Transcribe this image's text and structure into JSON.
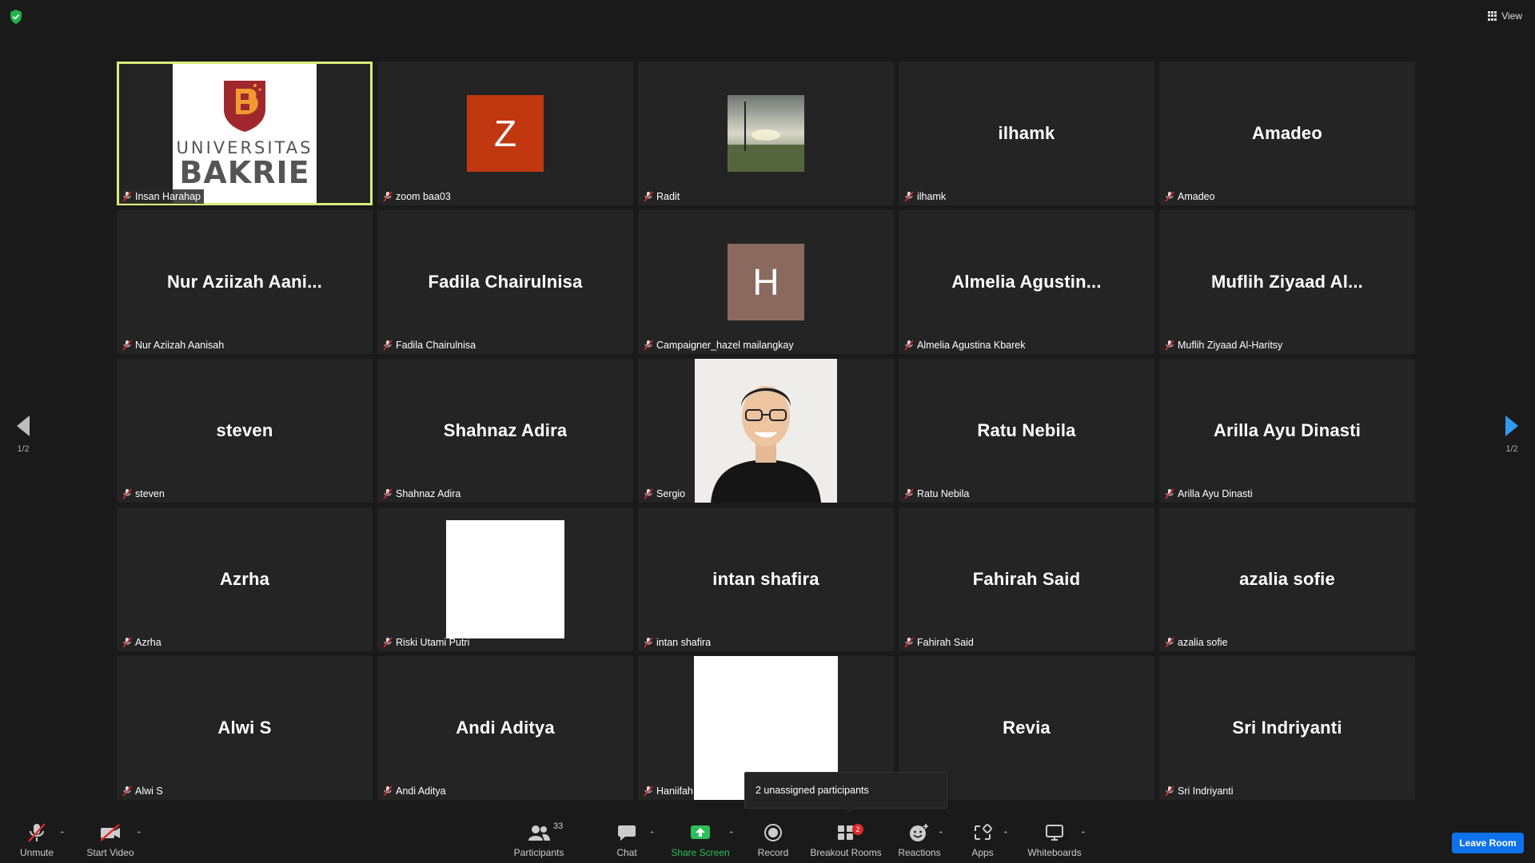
{
  "top_bar": {
    "view_label": "View"
  },
  "pager": {
    "left_page": "1/2",
    "right_page": "1/2"
  },
  "logo": {
    "line1": "UNIVERSITAS",
    "line2": "BAKRIE"
  },
  "tiles": [
    {
      "label": "Insan Harahap",
      "big": ""
    },
    {
      "label": "zoom baa03",
      "big": "",
      "avatar": "Z"
    },
    {
      "label": "Radit",
      "big": ""
    },
    {
      "label": "ilhamk",
      "big": "ilhamk"
    },
    {
      "label": "Amadeo",
      "big": "Amadeo"
    },
    {
      "label": "Nur Aziizah Aanisah",
      "big": "Nur  Aziizah  Aani..."
    },
    {
      "label": "Fadila Chairulnisa",
      "big": "Fadila Chairulnisa"
    },
    {
      "label": "Campaigner_hazel mailangkay",
      "big": "",
      "avatar": "H"
    },
    {
      "label": "Almelia Agustina Kbarek",
      "big": "Almelia  Agustin..."
    },
    {
      "label": "Muflih Ziyaad Al-Haritsy",
      "big": "Muflih  Ziyaad  Al..."
    },
    {
      "label": "steven",
      "big": "steven"
    },
    {
      "label": "Shahnaz Adira",
      "big": "Shahnaz Adira"
    },
    {
      "label": "Sergio",
      "big": ""
    },
    {
      "label": "Ratu Nebila",
      "big": "Ratu Nebila"
    },
    {
      "label": "Arilla Ayu Dinasti",
      "big": "Arilla Ayu Dinasti"
    },
    {
      "label": "Azrha",
      "big": "Azrha"
    },
    {
      "label": "Riski Utami Putri",
      "big": ""
    },
    {
      "label": "intan shafira",
      "big": "intan shafira"
    },
    {
      "label": "Fahirah Said",
      "big": "Fahirah Said"
    },
    {
      "label": "azalia sofie",
      "big": "azalia sofie"
    },
    {
      "label": "Alwi S",
      "big": "Alwi S"
    },
    {
      "label": "Andi Aditya",
      "big": "Andi Aditya"
    },
    {
      "label": "Haniifah Amar Aa",
      "big": ""
    },
    {
      "label": "",
      "big": "Revia"
    },
    {
      "label": "Sri Indriyanti",
      "big": "Sri Indriyanti"
    }
  ],
  "tooltip": {
    "text": "2 unassigned participants"
  },
  "toolbar": {
    "unmute": "Unmute",
    "start_video": "Start Video",
    "participants": "Participants",
    "participants_count": "33",
    "chat": "Chat",
    "share_screen": "Share Screen",
    "record": "Record",
    "breakout_rooms": "Breakout Rooms",
    "breakout_badge": "2",
    "reactions": "Reactions",
    "apps": "Apps",
    "whiteboards": "Whiteboards",
    "leave": "Leave Room"
  },
  "colors": {
    "background": "#1a1a1a",
    "tile": "#242424",
    "active_speaker": "#d8ec7c",
    "share_green": "#2ebf5a",
    "leave_blue": "#0e72ed",
    "avatar_z": "#c1370f",
    "avatar_h": "#8a6a5e",
    "mic_off_red": "#e02828"
  }
}
